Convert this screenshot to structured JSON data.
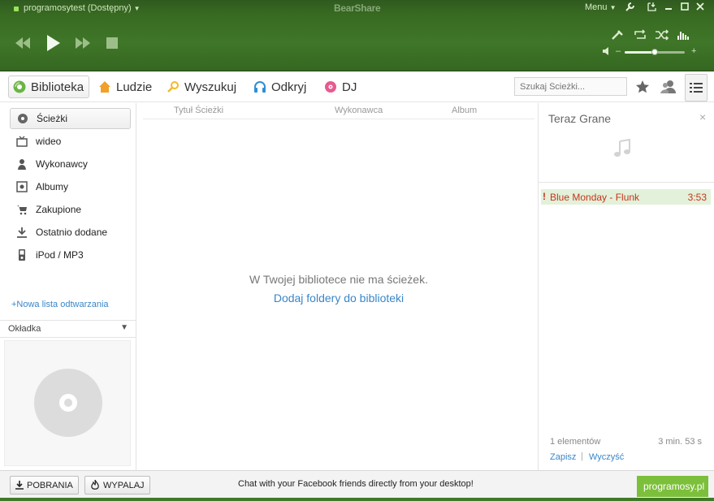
{
  "window": {
    "user_status": "programosytest (Dostępny)",
    "app_title": "BearShare",
    "menu_label": "Menu"
  },
  "player": {
    "volume_level": 0.5
  },
  "nav": {
    "tabs": [
      {
        "label": "Biblioteka"
      },
      {
        "label": "Ludzie"
      },
      {
        "label": "Wyszukuj"
      },
      {
        "label": "Odkryj"
      },
      {
        "label": "DJ"
      }
    ],
    "search_placeholder": "Szukaj Ścieżki..."
  },
  "sidebar": {
    "items": [
      {
        "label": "Ścieżki"
      },
      {
        "label": "wideo"
      },
      {
        "label": "Wykonawcy"
      },
      {
        "label": "Albumy"
      },
      {
        "label": "Zakupione"
      },
      {
        "label": "Ostatnio dodane"
      },
      {
        "label": "iPod / MP3"
      }
    ],
    "new_playlist": "+Nowa lista odtwarzania",
    "cover_label": "Okładka"
  },
  "library": {
    "columns": [
      "Tytuł Ścieżki",
      "Wykonawca",
      "Album"
    ],
    "empty_message": "W Twojej bibliotece nie ma ścieżek.",
    "add_folders": "Dodaj foldery do biblioteki"
  },
  "now_playing": {
    "title": "Teraz Grane",
    "tracks": [
      {
        "name": "Blue Monday - Flunk",
        "duration": "3:53"
      }
    ],
    "count": "1 elementów",
    "total": "3 min. 53 s",
    "save_label": "Zapisz",
    "clear_label": "Wyczyść"
  },
  "bottom": {
    "downloads_label": "POBRANIA",
    "burn_label": "WYPALAJ",
    "facebook_message": "Chat with your Facebook friends directly from your desktop!"
  },
  "watermark": "programosy.pl",
  "colors": {
    "accent_green": "#3f7628",
    "link_blue": "#3a86c8",
    "error_red": "#c8331c"
  }
}
